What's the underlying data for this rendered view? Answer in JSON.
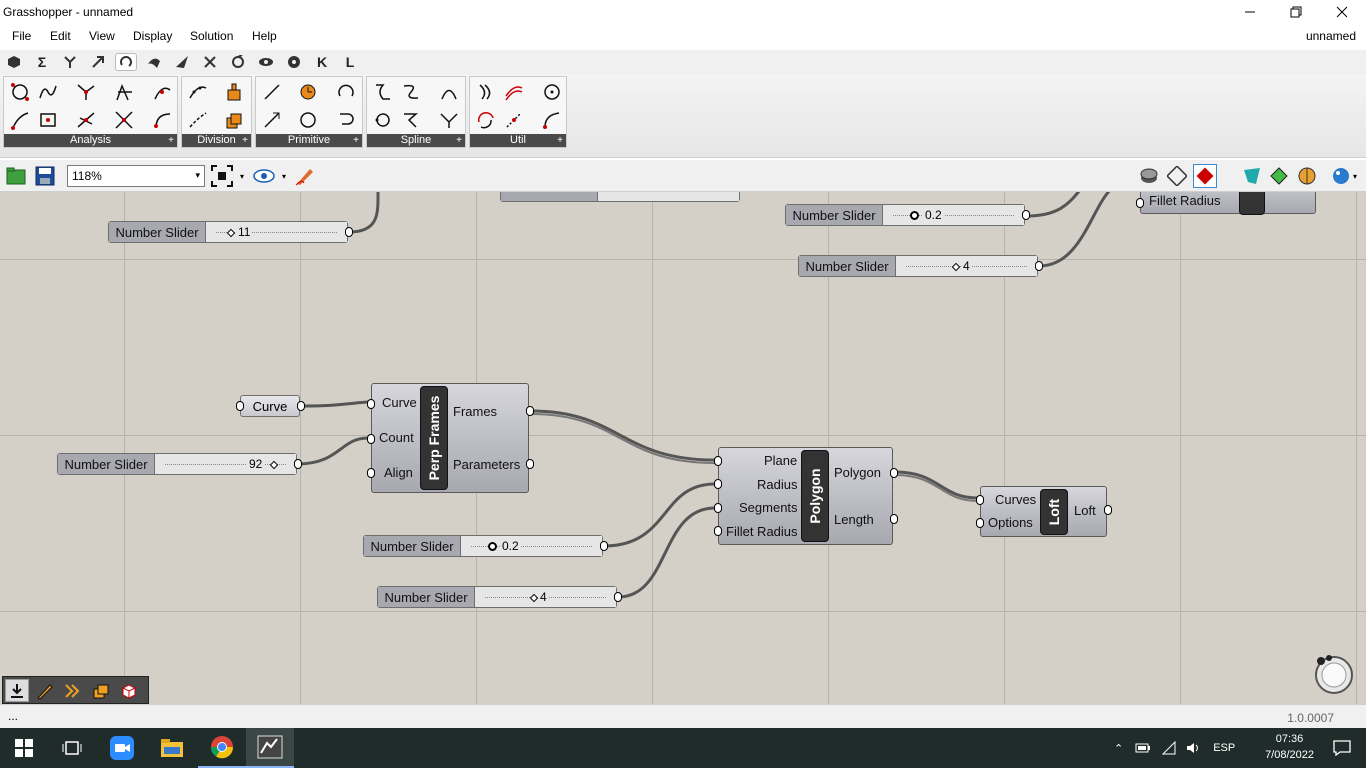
{
  "window": {
    "title": "Grasshopper - unnamed",
    "minimize_icon": "minimize-icon",
    "maximize_icon": "restore-icon",
    "close_icon": "close-icon"
  },
  "menu": {
    "items": [
      "File",
      "Edit",
      "View",
      "Display",
      "Solution",
      "Help"
    ],
    "document_name": "unnamed"
  },
  "category_tabs": [
    {
      "icon": "params-hexagon-icon"
    },
    {
      "icon": "sigma-icon",
      "glyph": "Σ"
    },
    {
      "icon": "sets-icon"
    },
    {
      "icon": "vector-icon"
    },
    {
      "icon": "curve-icon",
      "active": true
    },
    {
      "icon": "surface-icon"
    },
    {
      "icon": "mesh-icon"
    },
    {
      "icon": "intersect-icon"
    },
    {
      "icon": "transform-icon"
    },
    {
      "icon": "display-eye-icon"
    },
    {
      "icon": "rhino-icon"
    },
    {
      "icon": "kangaroo-icon",
      "glyph": "K"
    },
    {
      "icon": "ladybug-icon",
      "glyph": "L"
    }
  ],
  "ribbon": {
    "panels": [
      {
        "label": "Analysis"
      },
      {
        "label": "Division"
      },
      {
        "label": "Primitive"
      },
      {
        "label": "Spline"
      },
      {
        "label": "Util"
      }
    ],
    "expand_glyph": "+"
  },
  "canvas_toolbar": {
    "zoom": "118%",
    "open_icon": "open-folder-icon",
    "save_icon": "save-icon",
    "zoom_extents_icon": "zoom-extents-icon",
    "preview_icon": "eye-icon",
    "sketch_icon": "pen-icon"
  },
  "canvas": {
    "sliders": [
      {
        "name": "Number Slider",
        "value": "11"
      },
      {
        "name": "Number Slider",
        "value": "0.2"
      },
      {
        "name": "Number Slider",
        "value": "4"
      },
      {
        "name": "Number Slider",
        "value": "92"
      },
      {
        "name": "Number Slider",
        "value": "0.2"
      },
      {
        "name": "Number Slider",
        "value": "4"
      }
    ],
    "curve_param": "Curve",
    "perp_frames": {
      "name": "Perp Frames",
      "inputs": [
        "Curve",
        "Count",
        "Align"
      ],
      "outputs": [
        "Frames",
        "Parameters"
      ]
    },
    "polygon": {
      "name": "Polygon",
      "inputs": [
        "Plane",
        "Radius",
        "Segments",
        "Fillet Radius"
      ],
      "outputs": [
        "Polygon",
        "Length"
      ]
    },
    "loft": {
      "name": "Loft",
      "inputs": [
        "Curves",
        "Options"
      ],
      "outputs": [
        "Loft"
      ]
    },
    "partial_top_right": {
      "input": "Fillet Radius"
    }
  },
  "statusbar": {
    "text": "...",
    "version": "1.0.0007"
  },
  "taskbar": {
    "language": "ESP",
    "time": "07:36",
    "date": "7/08/2022"
  }
}
